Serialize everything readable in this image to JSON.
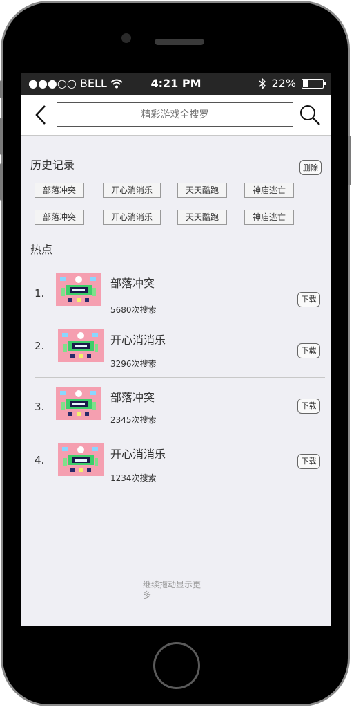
{
  "status_bar": {
    "carrier": "●●●○○ BELL",
    "time": "4:21 PM",
    "battery": "22%",
    "battery_level": 0.22
  },
  "nav": {
    "back_icon": "chevron-left-icon",
    "search_placeholder": "精彩游戏全搜罗",
    "search_icon": "magnifier-icon"
  },
  "history": {
    "title": "历史记录",
    "delete_label": "删除",
    "tags": [
      "部落冲突",
      "开心消消乐",
      "天天酷跑",
      "神庙逃亡",
      "部落冲突",
      "开心消消乐",
      "天天酷跑",
      "神庙逃亡"
    ]
  },
  "hot": {
    "title": "热点",
    "items": [
      {
        "rank": "1.",
        "name": "部落冲突",
        "count": "5680次搜索",
        "download": "下载"
      },
      {
        "rank": "2.",
        "name": "开心消消乐",
        "count": "3296次搜索",
        "download": "下载"
      },
      {
        "rank": "3.",
        "name": "部落冲突",
        "count": "2345次搜索",
        "download": "下载"
      },
      {
        "rank": "4.",
        "name": "开心消消乐",
        "count": "1234次搜索",
        "download": "下载"
      }
    ]
  },
  "footer": {
    "more": "继续拖动显示更多"
  },
  "colors": {
    "screen_bg": "#efeff4",
    "status_bg": "#262626",
    "thumb_bg": "#f59fb0"
  }
}
